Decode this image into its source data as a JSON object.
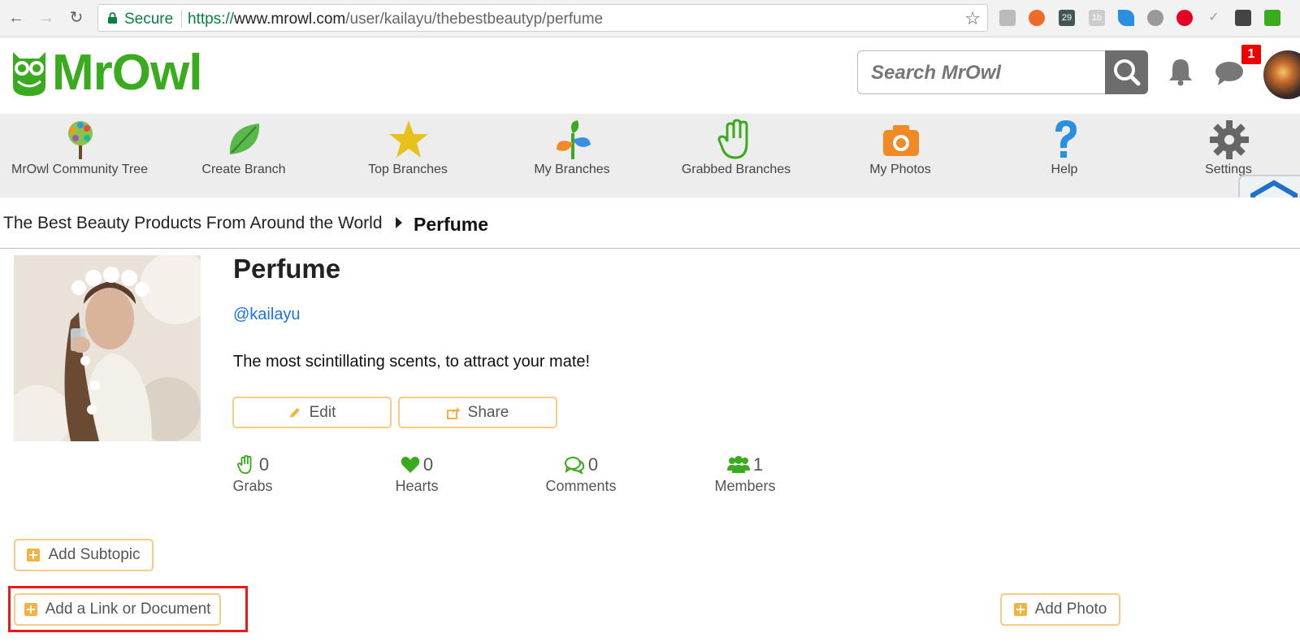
{
  "browser": {
    "secure_label": "Secure",
    "url_scheme": "https://",
    "url_domain": "www.mrowl.com",
    "url_path": "/user/kailayu/thebestbeautyp/perfume",
    "extension_badge": "29",
    "extension_1b": "1b"
  },
  "header": {
    "logo_text": "MrOwl",
    "search_placeholder": "Search MrOwl",
    "notification_count": "1"
  },
  "nav": {
    "items": [
      {
        "label": "MrOwl Community Tree",
        "icon": "tree-icon"
      },
      {
        "label": "Create Branch",
        "icon": "leaf-icon"
      },
      {
        "label": "Top Branches",
        "icon": "star-icon"
      },
      {
        "label": "My Branches",
        "icon": "sprout-icon"
      },
      {
        "label": "Grabbed Branches",
        "icon": "hand-icon"
      },
      {
        "label": "My Photos",
        "icon": "camera-icon"
      },
      {
        "label": "Help",
        "icon": "question-icon"
      },
      {
        "label": "Settings",
        "icon": "gear-icon"
      }
    ]
  },
  "breadcrumb": {
    "parent": "The Best Beauty Products From Around the World",
    "current": "Perfume"
  },
  "branch": {
    "title": "Perfume",
    "username": "@kailayu",
    "description": "The most scintillating scents, to attract your mate!",
    "edit_label": "Edit",
    "share_label": "Share"
  },
  "stats": [
    {
      "count": "0",
      "label": "Grabs"
    },
    {
      "count": "0",
      "label": "Hearts"
    },
    {
      "count": "0",
      "label": "Comments"
    },
    {
      "count": "1",
      "label": "Members"
    }
  ],
  "actions": {
    "add_subtopic": "Add Subtopic",
    "add_link": "Add a Link or Document",
    "add_photo": "Add Photo"
  },
  "colors": {
    "brand_green": "#3aaa1e",
    "button_border": "#f5cc84",
    "highlight_red": "#e81a1a",
    "link_blue": "#1a73e8"
  }
}
